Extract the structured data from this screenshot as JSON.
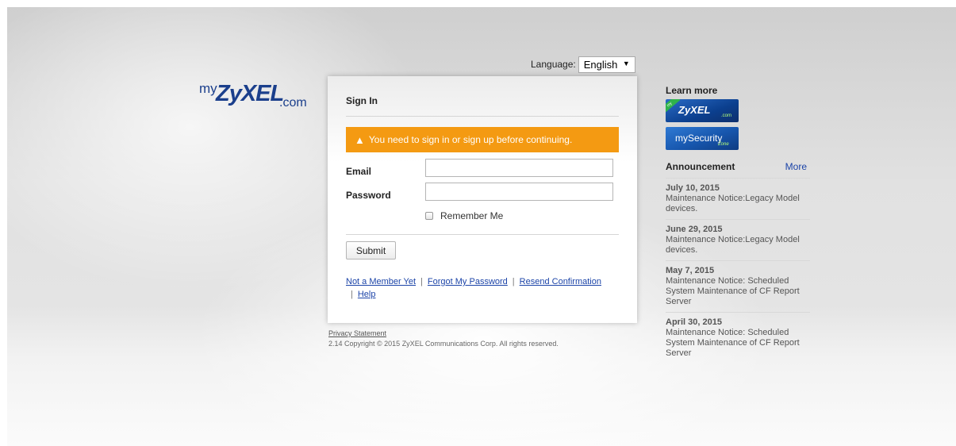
{
  "logo": {
    "my": "my",
    "brand": "ZyXEL",
    "dotcom": ".com"
  },
  "language": {
    "label": "Language:",
    "selected": "English"
  },
  "signin": {
    "title": "Sign In",
    "alert": "You need to sign in or sign up before continuing.",
    "email_label": "Email",
    "email_value": "",
    "password_label": "Password",
    "password_value": "",
    "remember_label": "Remember Me",
    "remember_checked": false,
    "submit_label": "Submit",
    "links": {
      "not_member": "Not a Member Yet",
      "forgot": "Forgot My Password",
      "resend": "Resend Confirmation",
      "help": "Help",
      "separator": "|"
    }
  },
  "footer": {
    "privacy": "Privacy Statement",
    "copyright": "2.14 Copyright © 2015 ZyXEL Communications Corp. All rights reserved."
  },
  "sidebar": {
    "learn_more": "Learn more",
    "badge_zyxel": {
      "corner": "my",
      "name": "ZyXEL",
      "suffix": ".com"
    },
    "badge_security": {
      "name": "mySecurity",
      "suffix": "Zone"
    },
    "announcement_title": "Announcement",
    "more_label": "More",
    "announcements": [
      {
        "date": "July 10, 2015",
        "text": "Maintenance Notice:Legacy Model devices."
      },
      {
        "date": "June 29, 2015",
        "text": "Maintenance Notice:Legacy Model devices."
      },
      {
        "date": "May 7, 2015",
        "text": "Maintenance Notice: Scheduled System Maintenance of CF Report Server"
      },
      {
        "date": "April 30, 2015",
        "text": "Maintenance Notice: Scheduled System Maintenance of CF Report Server"
      }
    ]
  },
  "colors": {
    "alert_bg": "#f49a12",
    "link": "#1c44a8",
    "brand_blue": "#1b3f8c"
  }
}
